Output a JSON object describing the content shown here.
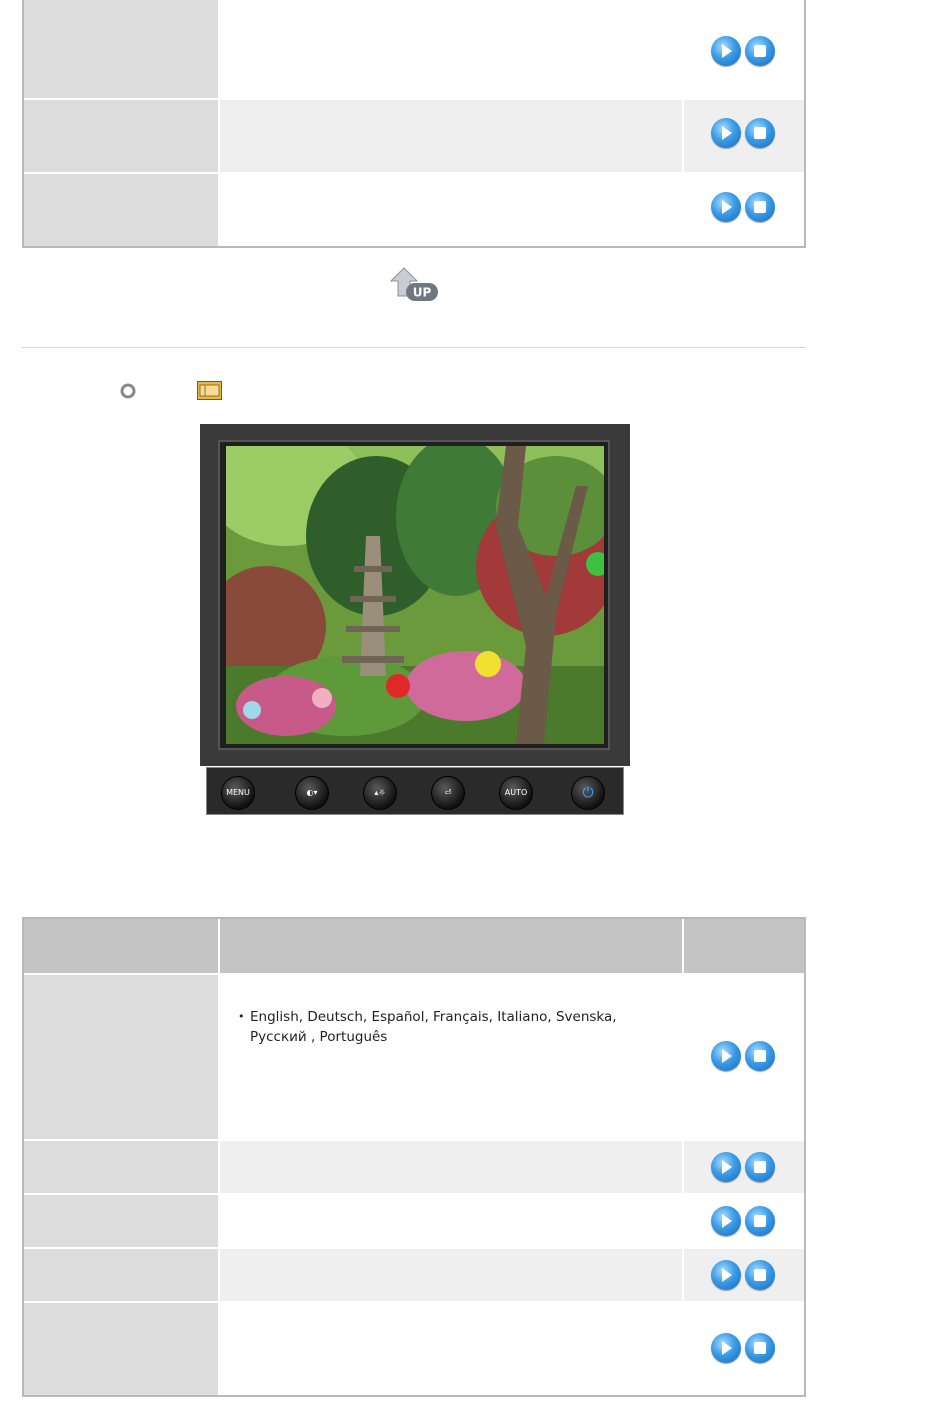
{
  "colors": {
    "label_cell": "#dcdcdc",
    "alt_row": "#efefef",
    "header_row": "#c4c4c4",
    "border": "#b9b9b9",
    "button_blue": "#3a9be6",
    "monitor_body": "#3a3a3a"
  },
  "icons": {
    "play": "play-icon",
    "stop": "stop-icon",
    "up": "up-arrow-icon",
    "bullet": "circle-bullet-icon",
    "osd": "osd-menu-icon"
  },
  "up_icon_label": "UP",
  "osd_buttons": [
    {
      "label": "MENU",
      "icon": "menu-icon"
    },
    {
      "label": "",
      "icon": "contrast-down-icon"
    },
    {
      "label": "",
      "icon": "brightness-up-icon"
    },
    {
      "label": "",
      "icon": "enter-icon"
    },
    {
      "label": "AUTO",
      "icon": "auto-icon"
    },
    {
      "label": "",
      "icon": "power-icon"
    }
  ],
  "language_table": {
    "language_list_line1": "English, Deutsch, Español, Français, Italiano, Svenska,",
    "language_list_line2": "Русский , Português"
  }
}
